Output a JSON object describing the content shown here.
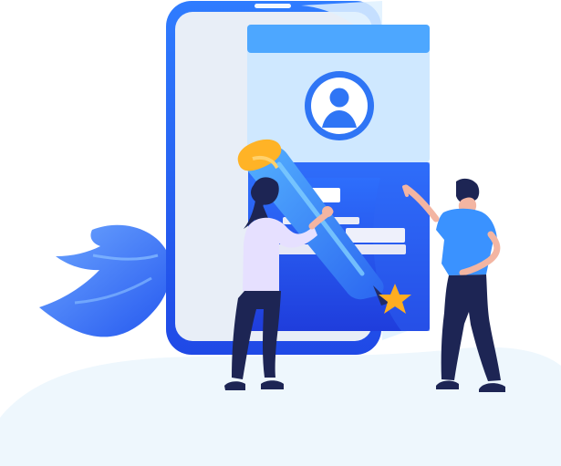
{
  "illustration": {
    "palette": {
      "primary_blue": "#2f6df6",
      "deep_blue": "#1f3ee8",
      "light_blue": "#d9ebff",
      "soft_blue": "#edf6ff",
      "cyan": "#65c9ff",
      "orange": "#ffb326",
      "navy": "#1d2554",
      "lavender": "#e7e1ff",
      "skin": "#f3b5a2"
    },
    "icons": [
      "phone-icon",
      "profile-avatar-icon",
      "pencil-icon",
      "star-icon",
      "leaf-icon",
      "woman-figure-icon",
      "man-figure-icon"
    ]
  }
}
